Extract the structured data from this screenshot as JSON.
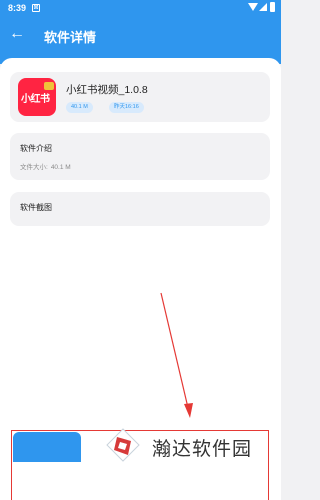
{
  "status_bar": {
    "time": "8:39",
    "notification_glyph": "⊠"
  },
  "header": {
    "title": "软件详情",
    "back_glyph": "←"
  },
  "app": {
    "name": "小红书视频_1.0.8",
    "icon_text": "小红书",
    "size_tag": "40.1 M",
    "date_tag": "昨天16:16",
    "brand_color": "#ff2442"
  },
  "intro": {
    "title": "软件介绍",
    "file_size_label": "文件大小:",
    "file_size_value": "40.1 M"
  },
  "screenshots": {
    "title": "软件截图"
  },
  "watermark": {
    "text": "瀚达软件园"
  },
  "colors": {
    "accent": "#2f96ee",
    "highlight": "#e53935"
  }
}
